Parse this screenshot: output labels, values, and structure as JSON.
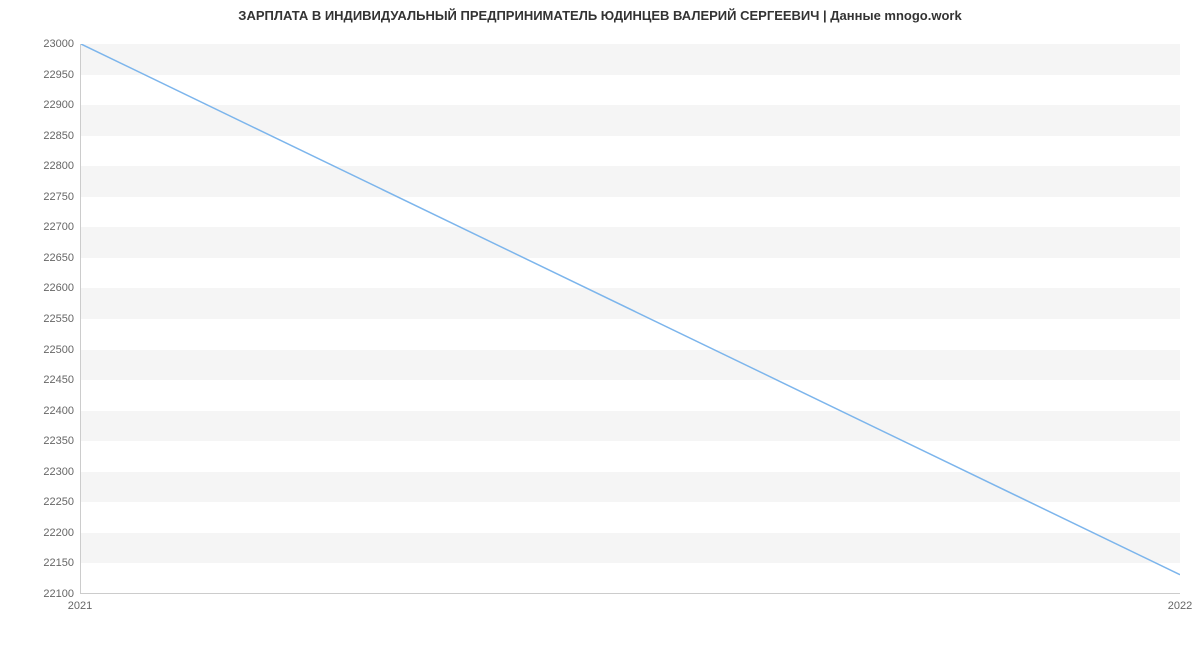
{
  "chart_data": {
    "type": "line",
    "title": "ЗАРПЛАТА В ИНДИВИДУАЛЬНЫЙ ПРЕДПРИНИМАТЕЛЬ ЮДИНЦЕВ ВАЛЕРИЙ СЕРГЕЕВИЧ | Данные mnogo.work",
    "x": [
      "2021",
      "2022"
    ],
    "values": [
      23000,
      22130
    ],
    "y_ticks": [
      23000,
      22950,
      22900,
      22850,
      22800,
      22750,
      22700,
      22650,
      22600,
      22550,
      22500,
      22450,
      22400,
      22350,
      22300,
      22250,
      22200,
      22150,
      22100
    ],
    "x_ticks": [
      "2021",
      "2022"
    ],
    "ylim": [
      22100,
      23000
    ],
    "xlabel": "",
    "ylabel": "",
    "grid": true,
    "line_color": "#7cb5ec"
  }
}
